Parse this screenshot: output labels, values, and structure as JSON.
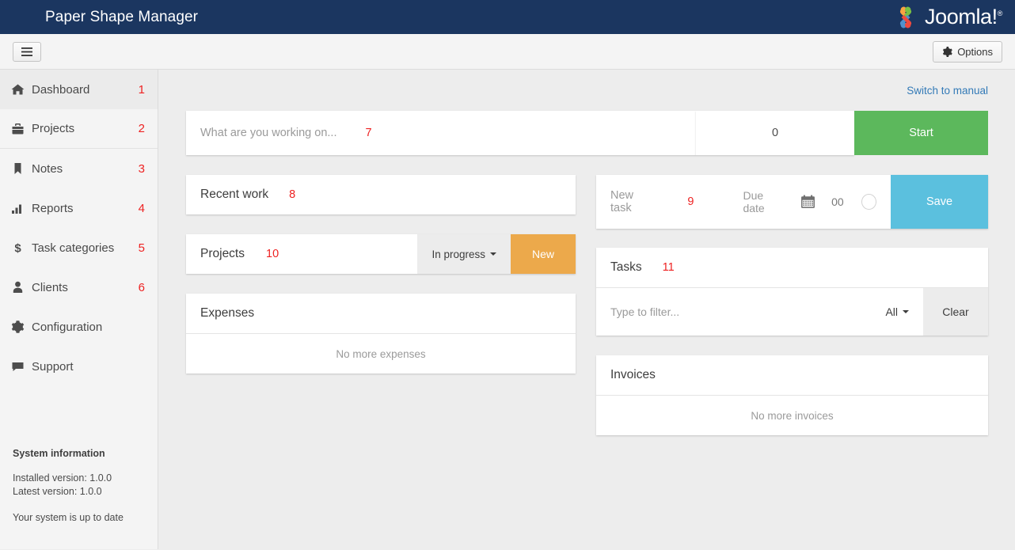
{
  "header": {
    "title": "Paper Shape Manager",
    "brand": "Joomla!",
    "brand_sup": "®",
    "navy": "#1b3660"
  },
  "toolbar": {
    "menu_icon": "hamburger-icon",
    "options_label": "Options",
    "options_icon": "gear-icon"
  },
  "sidebar": {
    "items": [
      {
        "label": "Dashboard",
        "num": "1",
        "icon": "home-icon",
        "active": true
      },
      {
        "label": "Projects",
        "num": "2",
        "icon": "briefcase-icon",
        "active": false
      },
      {
        "label": "Notes",
        "num": "3",
        "icon": "bookmark-icon",
        "active": false
      },
      {
        "label": "Reports",
        "num": "4",
        "icon": "bar-chart-icon",
        "active": false
      },
      {
        "label": "Task categories",
        "num": "5",
        "icon": "dollar-icon",
        "active": false
      },
      {
        "label": "Clients",
        "num": "6",
        "icon": "user-icon",
        "active": false
      },
      {
        "label": "Configuration",
        "num": "",
        "icon": "gear-icon",
        "active": false
      },
      {
        "label": "Support",
        "num": "",
        "icon": "comment-icon",
        "active": false
      }
    ],
    "system_info": {
      "title": "System information",
      "installed": "Installed version: 1.0.0",
      "latest": "Latest version: 1.0.0",
      "status": "Your system is up to date"
    }
  },
  "main": {
    "switch_link": "Switch to manual",
    "timer": {
      "placeholder": "What are you working on...",
      "num": "7",
      "value": "0",
      "start_label": "Start",
      "start_color": "#5cb85c"
    },
    "recent_work": {
      "title": "Recent work",
      "num": "8"
    },
    "projects": {
      "title": "Projects",
      "num": "10",
      "filter_label": "In progress",
      "new_label": "New",
      "new_color": "#eca94b"
    },
    "expenses": {
      "title": "Expenses",
      "empty": "No more expenses"
    },
    "new_task": {
      "placeholder": "New task",
      "num": "9",
      "due_date_label": "Due date",
      "calendar_icon": "calendar-icon",
      "time_value": "00",
      "priority_icon": "circle-icon",
      "save_label": "Save",
      "save_color": "#5bc0de"
    },
    "tasks": {
      "title": "Tasks",
      "num": "11",
      "filter_placeholder": "Type to filter...",
      "filter_select": "All",
      "clear_label": "Clear"
    },
    "invoices": {
      "title": "Invoices",
      "empty": "No more invoices"
    }
  }
}
